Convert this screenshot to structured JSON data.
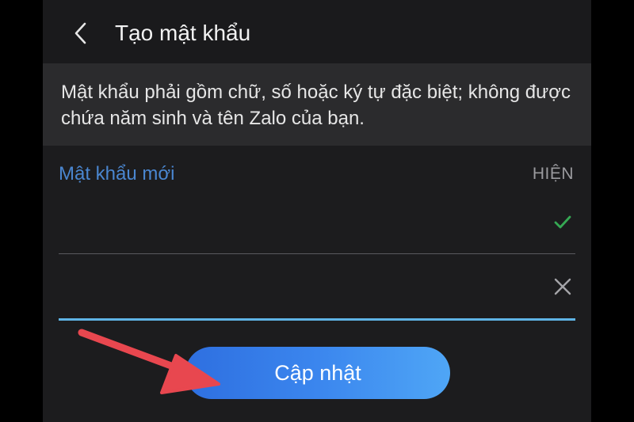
{
  "header": {
    "back_icon": "chevron-left-icon",
    "title": "Tạo mật khẩu"
  },
  "info": {
    "text": "Mật khẩu phải gồm chữ, số hoặc ký tự đặc biệt; không được chứa năm sinh và tên Zalo của bạn."
  },
  "form": {
    "new_password_label": "Mật khẩu mới",
    "show_label": "HIỆN",
    "new_password_value": "",
    "confirm_password_value": "",
    "valid_icon": "check-icon",
    "clear_icon": "close-icon"
  },
  "actions": {
    "update_label": "Cập nhật"
  },
  "colors": {
    "accent_label": "#4a86d0",
    "check": "#35a853",
    "focus_underline": "#5fb4e6",
    "button_gradient_start": "#2e6fe0",
    "button_gradient_end": "#4fa6f6",
    "annotation_arrow": "#e8474f"
  }
}
